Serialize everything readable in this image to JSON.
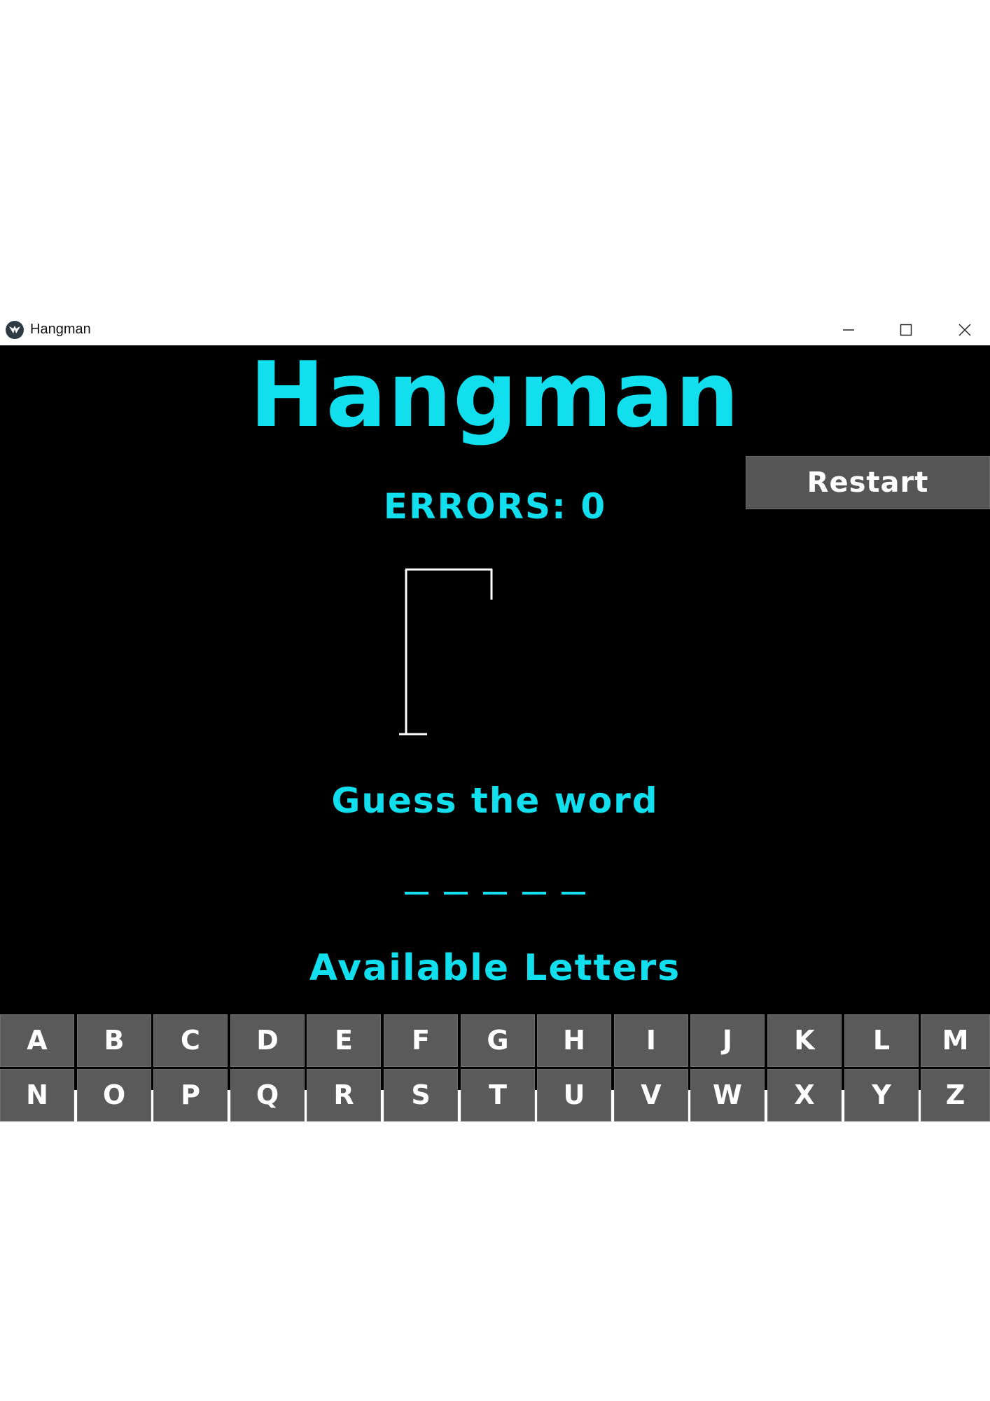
{
  "window": {
    "title": "Hangman",
    "controls": {
      "minimize": "minimize-icon",
      "maximize": "maximize-icon",
      "close": "close-icon"
    }
  },
  "game": {
    "title": "Hangman",
    "errors_text": "ERRORS: 0",
    "restart_label": "Restart",
    "guess_label": "Guess the word",
    "word_length": 5,
    "available_label": "Available Letters"
  },
  "keyboard": {
    "rows": [
      [
        "A",
        "B",
        "C",
        "D",
        "E",
        "F",
        "G",
        "H",
        "I",
        "J",
        "K",
        "L",
        "M"
      ],
      [
        "N",
        "O",
        "P",
        "Q",
        "R",
        "S",
        "T",
        "U",
        "V",
        "W",
        "X",
        "Y",
        "Z"
      ]
    ]
  },
  "colors": {
    "accent": "#11dfee",
    "background": "#000000",
    "key": "#5a5a5a",
    "button": "#555555"
  }
}
